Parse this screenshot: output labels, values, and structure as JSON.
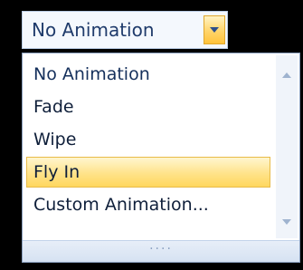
{
  "combo": {
    "value": "No Animation",
    "dropdown_icon": "chevron-down-icon"
  },
  "list": {
    "items": [
      {
        "label": "No Animation"
      },
      {
        "label": "Fade"
      },
      {
        "label": "Wipe"
      },
      {
        "label": "Fly In"
      },
      {
        "label": "Custom Animation..."
      }
    ],
    "selected_index": 3
  },
  "scrollbar": {
    "up_icon": "scroll-up-arrow-icon",
    "down_icon": "scroll-down-arrow-icon"
  },
  "grip": {
    "label": "····"
  },
  "colors": {
    "background": "#000000",
    "highlight": "#ffe38a",
    "text": "#0f1f3a"
  }
}
